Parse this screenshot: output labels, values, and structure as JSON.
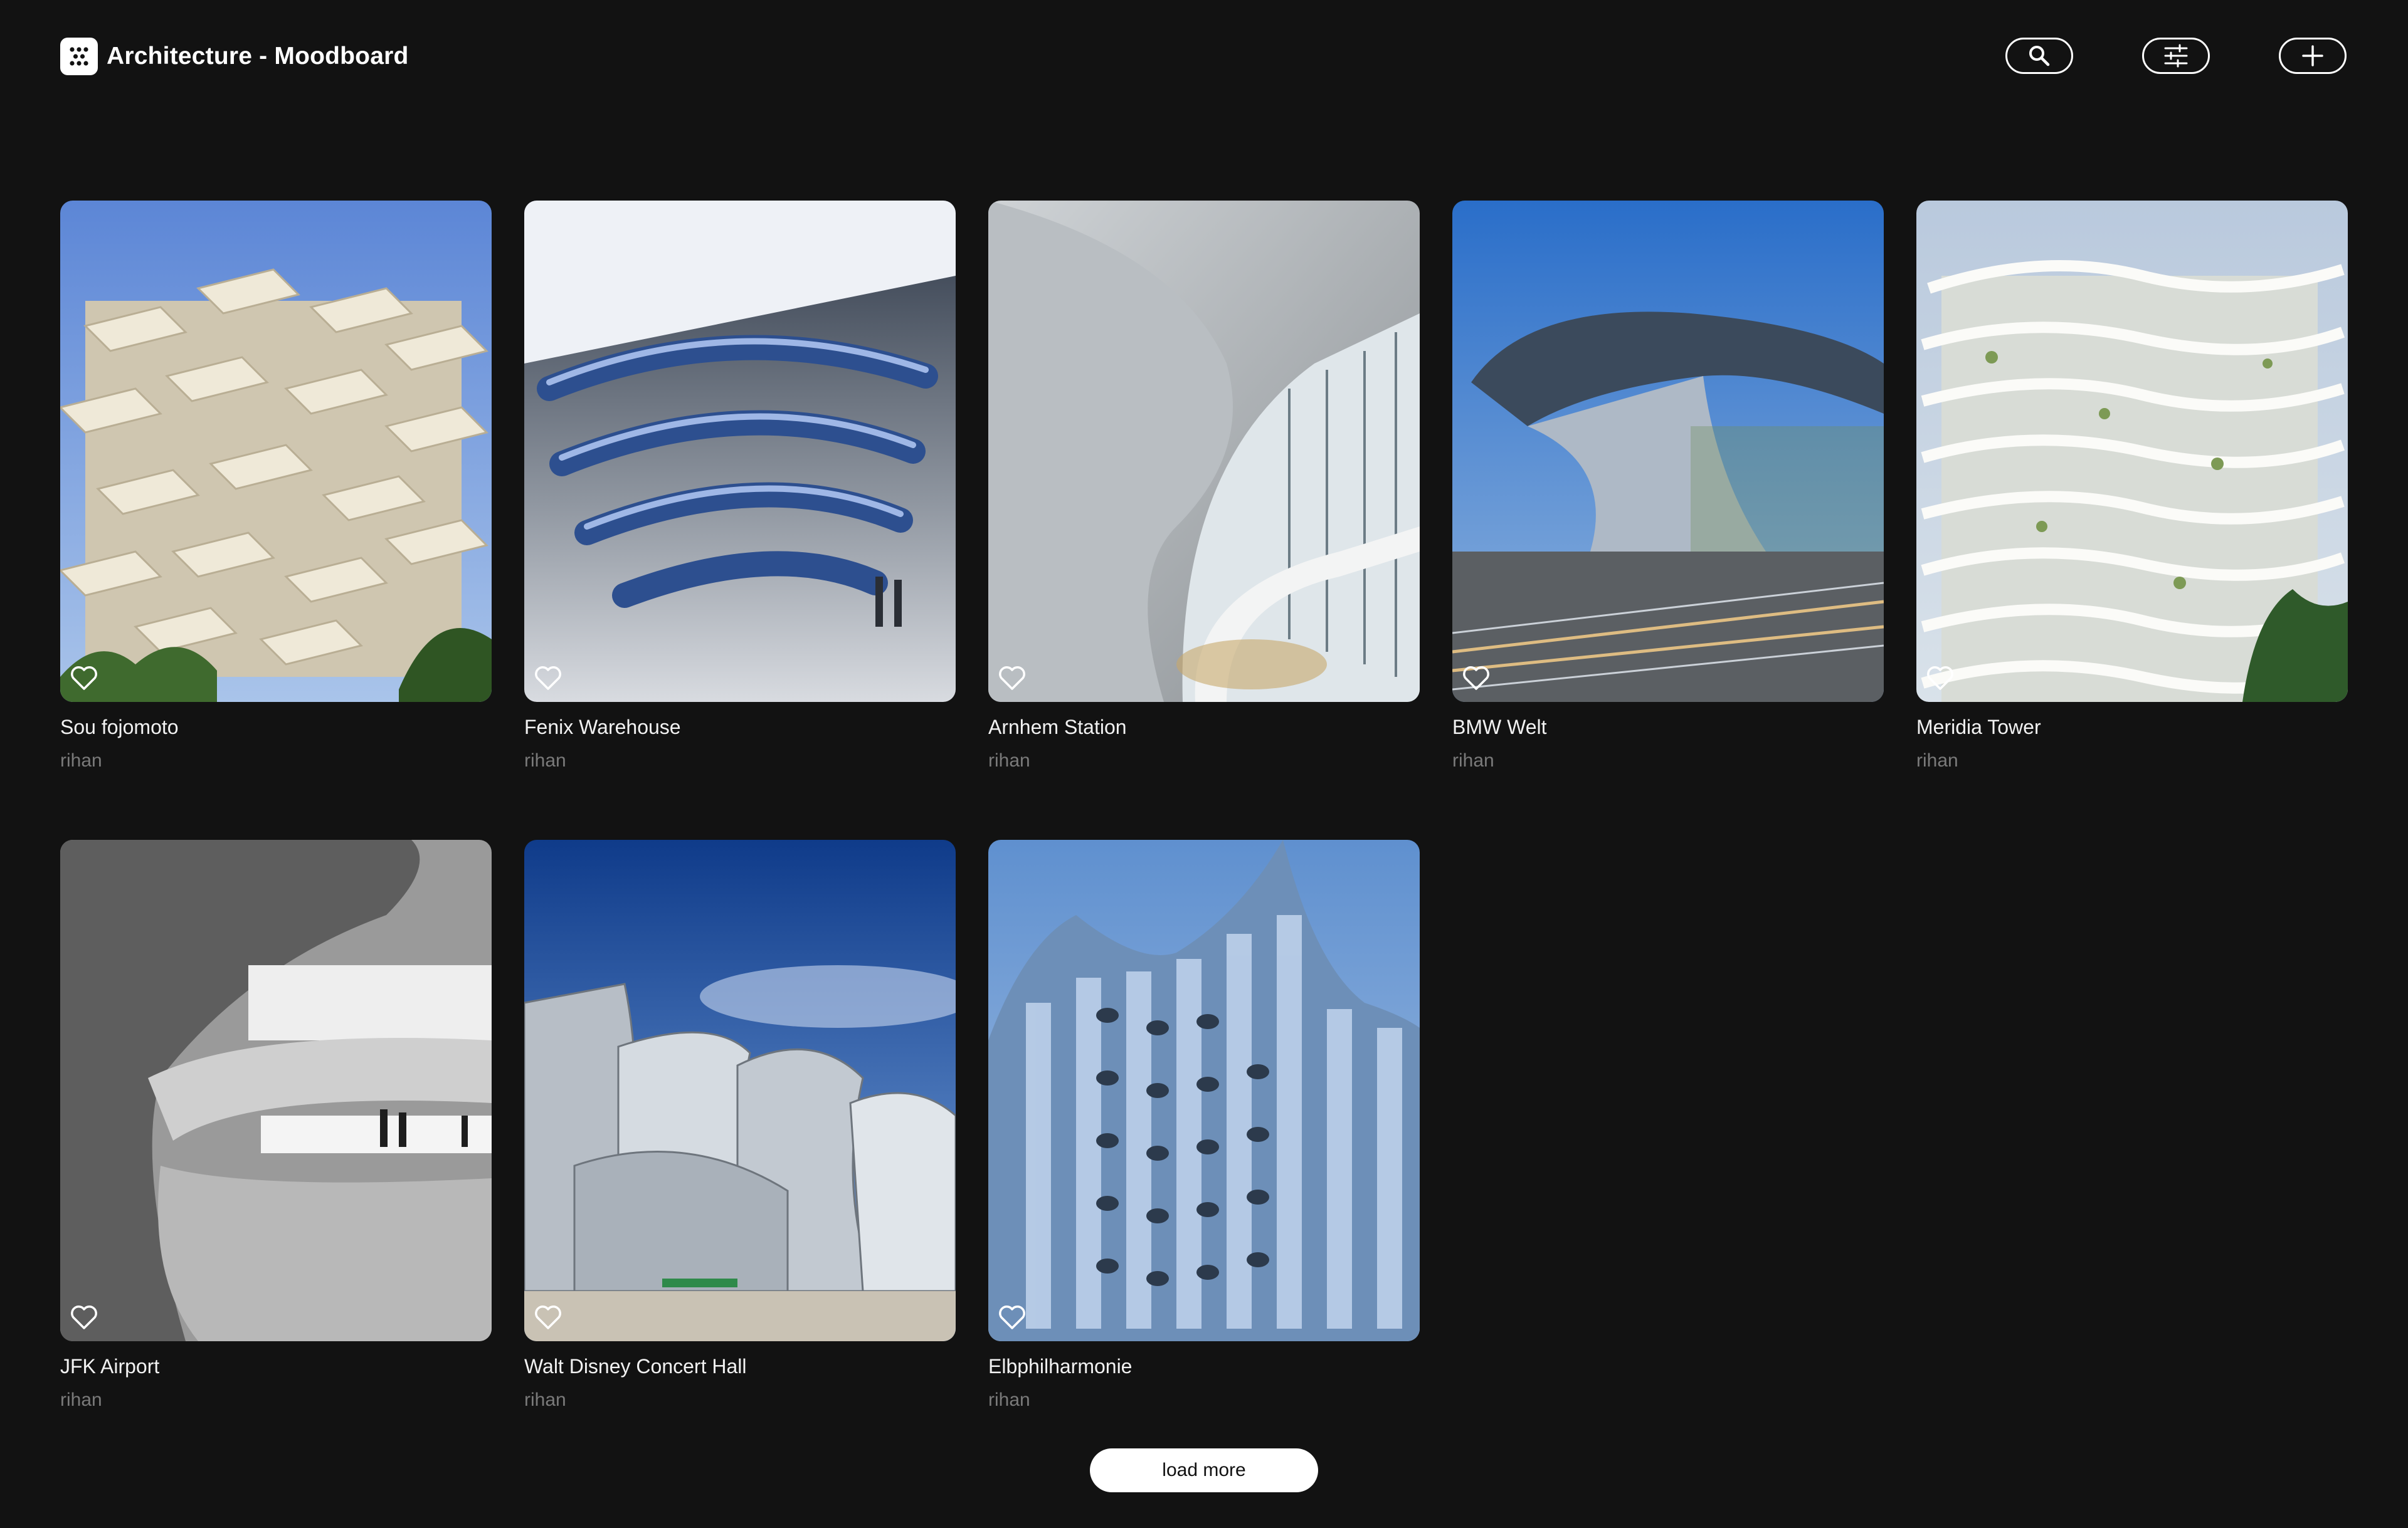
{
  "header": {
    "title": "Architecture - Moodboard",
    "logo_icon": "dice-grid-icon",
    "actions": [
      {
        "name": "search-button",
        "icon": "search-icon"
      },
      {
        "name": "filter-button",
        "icon": "sliders-icon"
      },
      {
        "name": "add-button",
        "icon": "plus-icon"
      }
    ]
  },
  "cards": [
    {
      "title": "Sou fojomoto",
      "author": "rihan",
      "liked": false
    },
    {
      "title": "Fenix Warehouse",
      "author": "rihan",
      "liked": false
    },
    {
      "title": "Arnhem Station",
      "author": "rihan",
      "liked": false
    },
    {
      "title": "BMW Welt",
      "author": "rihan",
      "liked": false
    },
    {
      "title": "Meridia Tower",
      "author": "rihan",
      "liked": false
    },
    {
      "title": "JFK Airport",
      "author": "rihan",
      "liked": false
    },
    {
      "title": "Walt Disney Concert Hall",
      "author": "rihan",
      "liked": false
    },
    {
      "title": "Elbphilharmonie",
      "author": "rihan",
      "liked": false
    }
  ],
  "load_more_label": "load more",
  "colors": {
    "background": "#121212",
    "text": "#ffffff",
    "muted_text": "#7a7a7a",
    "button_bg": "#ffffff"
  }
}
